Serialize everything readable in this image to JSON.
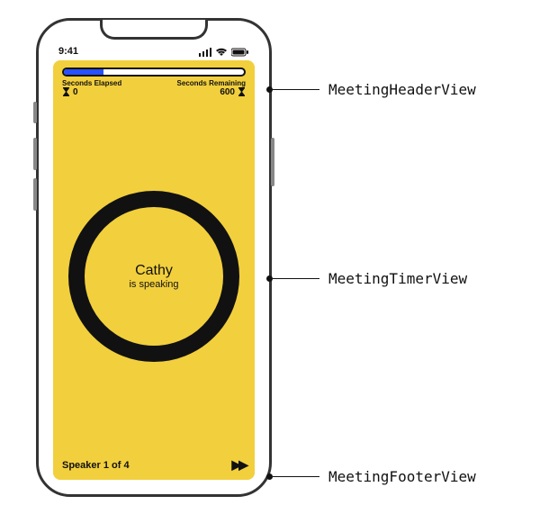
{
  "statusbar": {
    "time": "9:41"
  },
  "header": {
    "elapsed_label": "Seconds Elapsed",
    "remaining_label": "Seconds Remaining",
    "elapsed_value": "0",
    "remaining_value": "600",
    "progress_percent": 22
  },
  "timer": {
    "speaker_name": "Cathy",
    "subtitle": "is speaking"
  },
  "footer": {
    "speaker_count": "Speaker 1 of 4"
  },
  "annotations": {
    "header": "MeetingHeaderView",
    "timer": "MeetingTimerView",
    "footer": "MeetingFooterView"
  },
  "colors": {
    "theme": "#f2cf3d",
    "progress": "#2850ff",
    "stroke": "#111111"
  }
}
